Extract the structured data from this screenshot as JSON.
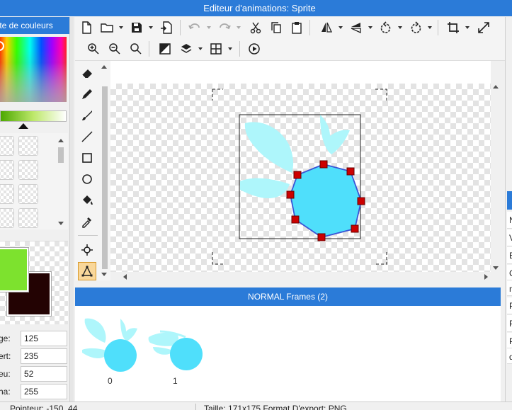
{
  "window": {
    "title": "Editeur d'animations: Sprite"
  },
  "palette": {
    "header": "tte de couleurs",
    "primary_color": "#7de22e",
    "secondary_color": "#230303"
  },
  "rgba": [
    {
      "label": "ge:",
      "value": "125"
    },
    {
      "label": "ert:",
      "value": "235"
    },
    {
      "label": "eu:",
      "value": "52"
    },
    {
      "label": "ha:",
      "value": "255"
    }
  ],
  "toolbar": {
    "row1": [
      "new-document-icon",
      "open-folder-icon",
      "save-icon",
      "export-icon",
      "undo-icon",
      "redo-icon",
      "cut-icon",
      "copy-icon",
      "paste-icon",
      "flip-horizontal-icon",
      "flip-vertical-icon",
      "rotate-left-icon",
      "rotate-right-icon",
      "crop-icon",
      "resize-icon"
    ],
    "row2": [
      "zoom-in-icon",
      "zoom-out-icon",
      "zoom-reset-icon",
      "mask-icon",
      "layers-icon",
      "grid-icon",
      "play-icon"
    ]
  },
  "tools": [
    "eraser-icon",
    "pencil-icon",
    "brush-icon",
    "line-icon",
    "rectangle-icon",
    "ellipse-icon",
    "fill-bucket-icon",
    "eyedropper-icon",
    "pivot-icon",
    "collision-polygon-icon"
  ],
  "right_panel": {
    "rows": [
      "N",
      "V",
      "E",
      "C",
      "n",
      "P",
      "P",
      "P",
      "d"
    ]
  },
  "frames": {
    "header": "NORMAL Frames (2)",
    "items": [
      {
        "label": "0"
      },
      {
        "label": "1"
      }
    ]
  },
  "status": {
    "pointer": "Pointeur: -150, 44",
    "info": "Taille: 171x175   Format D'export: PNG"
  },
  "colors": {
    "accent": "#2b7bd8",
    "sprite_light": "#aef6fb",
    "sprite_main": "#4fdffb",
    "polygon_stroke": "#3a55d6",
    "polygon_point": "#cc0000"
  }
}
